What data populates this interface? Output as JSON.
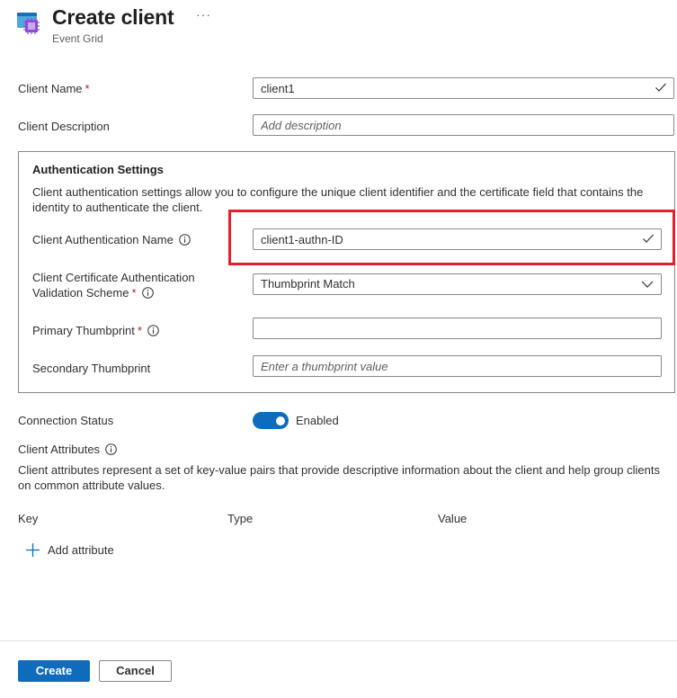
{
  "header": {
    "title": "Create client",
    "subtitle": "Event Grid",
    "more_label": "···",
    "icon": "event-grid-icon"
  },
  "form": {
    "client_name": {
      "label": "Client Name",
      "required": "*",
      "value": "client1"
    },
    "client_description": {
      "label": "Client Description",
      "placeholder": "Add description",
      "value": ""
    }
  },
  "auth": {
    "heading": "Authentication Settings",
    "description": "Client authentication settings allow you to configure the unique client identifier and the certificate field that contains the identity to authenticate the client.",
    "auth_name": {
      "label": "Client Authentication Name",
      "value": "client1-authn-ID"
    },
    "validation_scheme": {
      "label_line1": "Client Certificate Authentication",
      "label_line2": "Validation Scheme",
      "required": "*",
      "value": "Thumbprint Match"
    },
    "primary_thumbprint": {
      "label": "Primary Thumbprint",
      "required": "*",
      "value": ""
    },
    "secondary_thumbprint": {
      "label": "Secondary Thumbprint",
      "placeholder": "Enter a thumbprint value",
      "value": ""
    }
  },
  "connection": {
    "label": "Connection Status",
    "toggle_label": "Enabled",
    "enabled": true
  },
  "attributes": {
    "label": "Client Attributes",
    "description": "Client attributes represent a set of key-value pairs that provide descriptive information about the client and help group clients on common attribute values.",
    "columns": [
      "Key",
      "Type",
      "Value"
    ],
    "add_label": "Add attribute"
  },
  "footer": {
    "create_label": "Create",
    "cancel_label": "Cancel"
  },
  "colors": {
    "accent": "#0f6cbd",
    "highlight": "#e0202a",
    "required": "#a4262c"
  }
}
